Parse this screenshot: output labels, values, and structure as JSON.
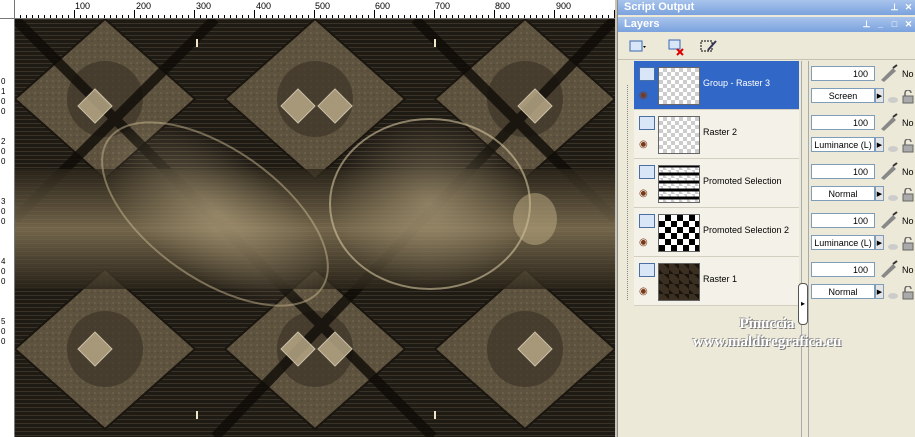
{
  "ruler": {
    "top_labels": [
      "100",
      "200",
      "300",
      "400",
      "500",
      "600",
      "700",
      "800",
      "900"
    ],
    "left_labels": [
      "0",
      "1",
      "0",
      "0",
      "2",
      "0",
      "0",
      "3",
      "0",
      "0",
      "4",
      "0",
      "0",
      "5",
      "0",
      "0"
    ]
  },
  "panels": {
    "script_output_title": "Script Output",
    "layers_title": "Layers"
  },
  "layers": [
    {
      "name": "Group - Raster 3",
      "opacity": "100",
      "blend": "Screen",
      "selected": true
    },
    {
      "name": "Raster 2",
      "opacity": "100",
      "blend": "Luminance (L)",
      "selected": false
    },
    {
      "name": "Promoted Selection",
      "opacity": "100",
      "blend": "Normal",
      "selected": false
    },
    {
      "name": "Promoted Selection 2",
      "opacity": "100",
      "blend": "Luminance (L)",
      "selected": false
    },
    {
      "name": "Raster 1",
      "opacity": "100",
      "blend": "Normal",
      "selected": false
    }
  ],
  "props_label": "No",
  "watermark": {
    "line1": "Pinuccia",
    "line2": "www.maldiregrafica.eu"
  },
  "colors": {
    "accent": "#3167c6",
    "titlebar": "#7aa2de",
    "canvas_bg": "#2b2418",
    "beige": "#8a7b5c"
  }
}
